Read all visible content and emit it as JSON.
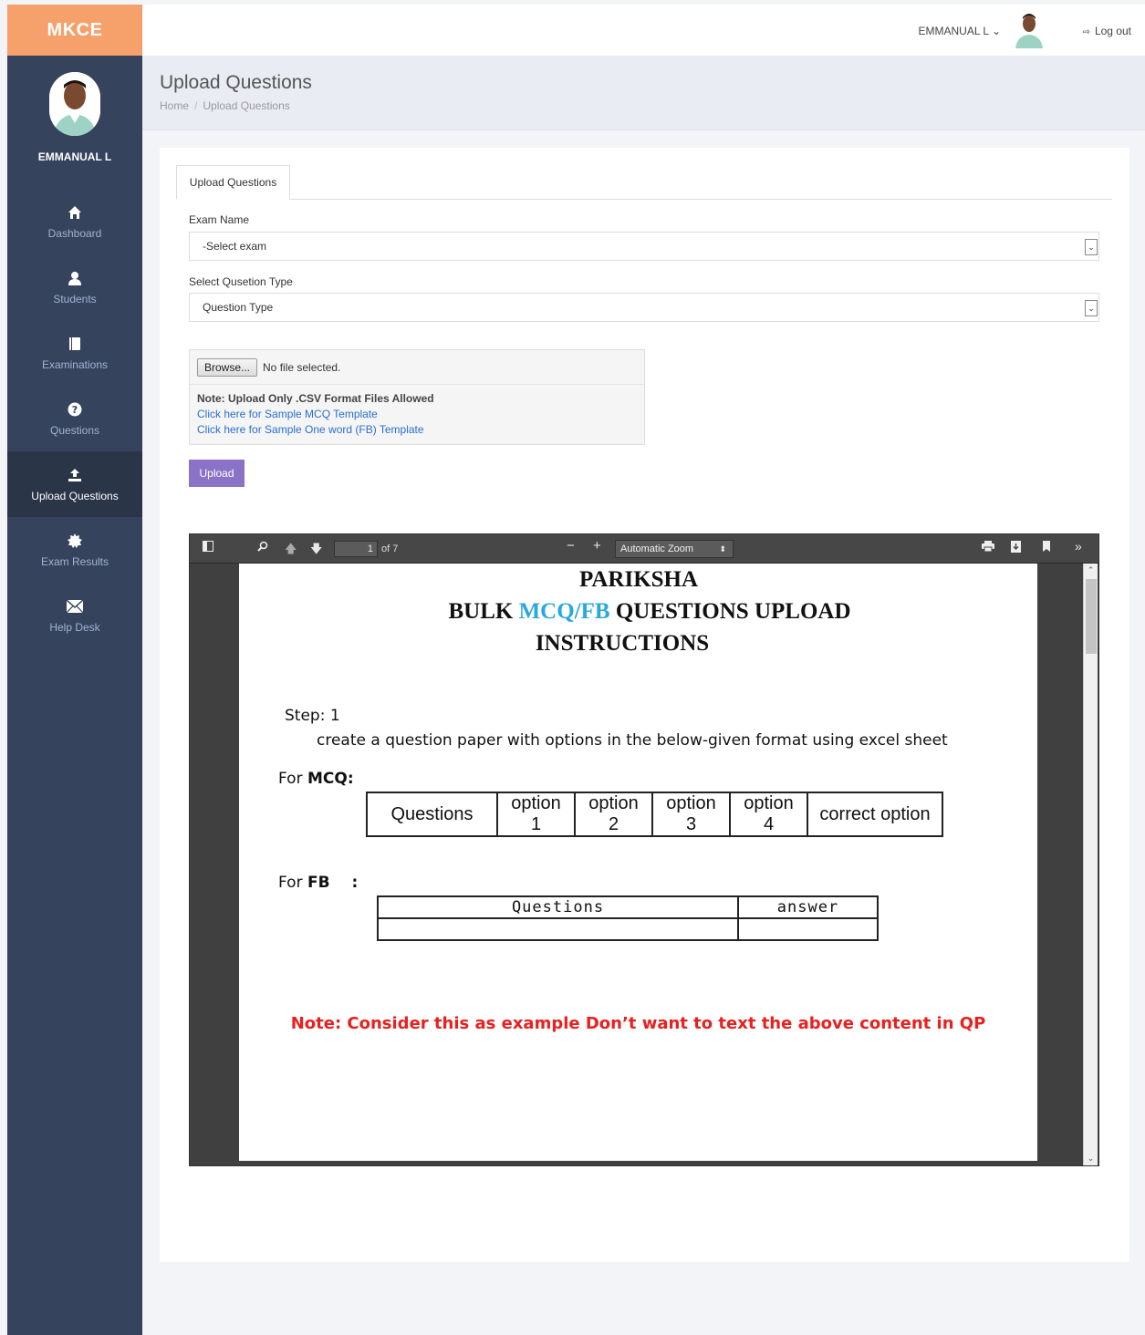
{
  "brand": "MKCE",
  "user": {
    "name": "EMMANUAL L",
    "menu_label": "EMMANUAL L ⌄"
  },
  "logout_label": "Log out",
  "nav": [
    {
      "label": "Dashboard",
      "icon": "home-icon"
    },
    {
      "label": "Students",
      "icon": "user-icon"
    },
    {
      "label": "Examinations",
      "icon": "book-icon"
    },
    {
      "label": "Questions",
      "icon": "question-icon"
    },
    {
      "label": "Upload Questions",
      "icon": "upload-icon",
      "active": true
    },
    {
      "label": "Exam Results",
      "icon": "certificate-icon"
    },
    {
      "label": "Help Desk",
      "icon": "envelope-icon"
    }
  ],
  "page": {
    "title": "Upload Questions",
    "breadcrumb": [
      "Home",
      "Upload Questions"
    ]
  },
  "form": {
    "tab": "Upload Questions",
    "exam_label": "Exam Name",
    "exam_value": "-Select exam",
    "type_label": "Select Qusetion Type",
    "type_value": "Question Type",
    "browse_label": "Browse...",
    "file_status": "No file selected.",
    "note": "Note: Upload Only .CSV Format Files Allowed",
    "link_mcq": "Click here for Sample MCQ Template",
    "link_fb": "Click here for Sample One word (FB) Template",
    "upload_label": "Upload"
  },
  "pdf": {
    "page_number": "1",
    "page_of": "of 7",
    "zoom": "Automatic Zoom",
    "title_line1": "PARIKSHA",
    "title_line2_prefix": "BULK ",
    "title_line2_highlight": "MCQ/FB",
    "title_line2_suffix": " QUESTIONS UPLOAD",
    "title_line3": "INSTRUCTIONS",
    "step": "Step: 1",
    "step_text": "create a question paper with options in the below-given format using excel sheet",
    "for_mcq_prefix": "For ",
    "for_mcq_bold": "MCQ:",
    "mcq_headers": [
      "Questions",
      "option 1",
      "option 2",
      "option 3",
      "option 4",
      "correct option"
    ],
    "for_fb_prefix": "For ",
    "for_fb_bold": "FB",
    "for_fb_colon": ":",
    "fb_headers": [
      "Questions",
      "answer"
    ],
    "note": "Note: Consider this as example Don’t want to text the above content in QP"
  },
  "colors": {
    "brand": "#f6a06b",
    "sidebar": "#36435c",
    "button": "#8a73c7",
    "link": "#2a6fd1",
    "note_red": "#e8201f",
    "highlight_blue": "#2aa7e0"
  }
}
